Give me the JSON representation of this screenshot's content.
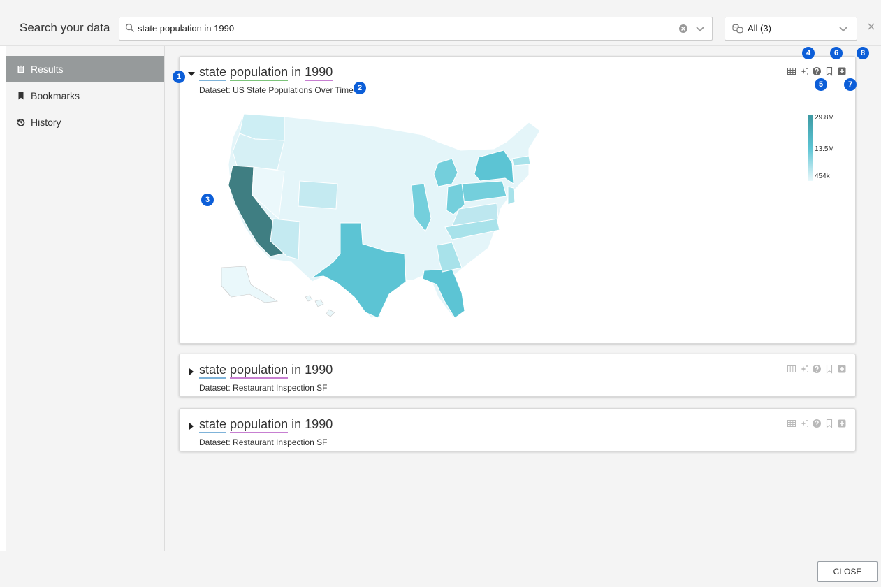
{
  "header": {
    "search_label": "Search your data",
    "search_value": "state population in 1990",
    "source_value": "All (3)"
  },
  "sidebar": {
    "items": [
      {
        "label": "Results",
        "icon": "clipboard-icon",
        "active": true
      },
      {
        "label": "Bookmarks",
        "icon": "bookmark-icon",
        "active": false
      },
      {
        "label": "History",
        "icon": "history-icon",
        "active": false
      }
    ]
  },
  "results": [
    {
      "title_words": [
        "state",
        "population",
        "in",
        "1990"
      ],
      "dataset": "Dataset: US State Populations Over Time",
      "expanded": true
    },
    {
      "title_words": [
        "state",
        "population",
        "in",
        "1990"
      ],
      "dataset": "Dataset: Restaurant Inspection SF",
      "expanded": false
    },
    {
      "title_words": [
        "state",
        "population",
        "in",
        "1990"
      ],
      "dataset": "Dataset: Restaurant Inspection SF",
      "expanded": false
    }
  ],
  "tools": [
    "table-icon",
    "sparkle-icon",
    "help-icon",
    "bookmark-outline-icon",
    "plus-box-icon"
  ],
  "legend": {
    "max": "29.8M",
    "mid": "13.5M",
    "min": "454k",
    "color_high": "#3d9aa3",
    "color_mid": "#5cc4d4",
    "color_low": "#eaf8fb"
  },
  "callouts": [
    "1",
    "2",
    "3",
    "4",
    "5",
    "6",
    "7",
    "8"
  ],
  "footer": {
    "close_label": "CLOSE"
  },
  "colors": {
    "accent_blue": "#0c5ed8",
    "sidebar_active": "#969a9b"
  }
}
